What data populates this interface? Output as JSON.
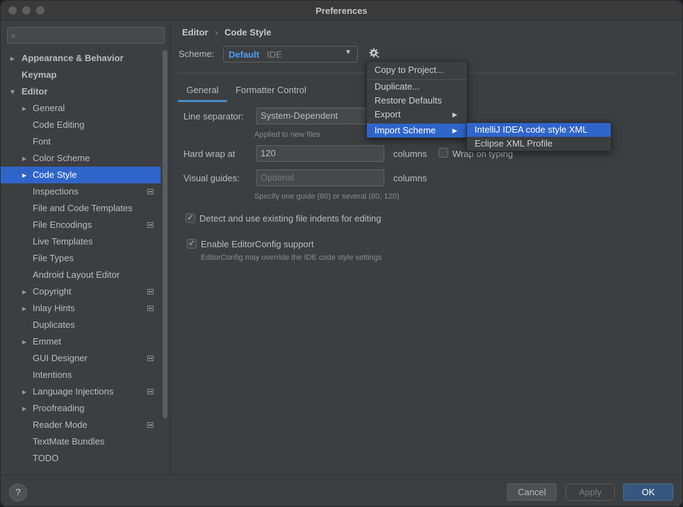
{
  "window": {
    "title": "Preferences"
  },
  "sidebar": {
    "search": {
      "placeholder": "",
      "icon": "search-icon"
    },
    "items": [
      {
        "label": "Appearance & Behavior",
        "expander": "▸"
      },
      {
        "label": "Keymap",
        "expander": ""
      },
      {
        "label": "Editor",
        "expander": "▾"
      },
      {
        "label": "General",
        "expander": "▸"
      },
      {
        "label": "Code Editing",
        "expander": ""
      },
      {
        "label": "Font",
        "expander": ""
      },
      {
        "label": "Color Scheme",
        "expander": "▸"
      },
      {
        "label": "Code Style",
        "expander": "▸",
        "selected": true
      },
      {
        "label": "Inspections",
        "expander": "",
        "project_icon": true
      },
      {
        "label": "File and Code Templates",
        "expander": ""
      },
      {
        "label": "File Encodings",
        "expander": "",
        "project_icon": true
      },
      {
        "label": "Live Templates",
        "expander": ""
      },
      {
        "label": "File Types",
        "expander": ""
      },
      {
        "label": "Android Layout Editor",
        "expander": ""
      },
      {
        "label": "Copyright",
        "expander": "▸",
        "project_icon": true
      },
      {
        "label": "Inlay Hints",
        "expander": "▸",
        "project_icon": true
      },
      {
        "label": "Duplicates",
        "expander": ""
      },
      {
        "label": "Emmet",
        "expander": "▸"
      },
      {
        "label": "GUI Designer",
        "expander": "",
        "project_icon": true
      },
      {
        "label": "Intentions",
        "expander": ""
      },
      {
        "label": "Language Injections",
        "expander": "▸",
        "project_icon": true
      },
      {
        "label": "Proofreading",
        "expander": "▸"
      },
      {
        "label": "Reader Mode",
        "expander": "",
        "project_icon": true
      },
      {
        "label": "TextMate Bundles",
        "expander": ""
      },
      {
        "label": "TODO",
        "expander": ""
      }
    ]
  },
  "breadcrumb": {
    "parent": "Editor",
    "separator": "›",
    "current": "Code Style"
  },
  "scheme": {
    "label": "Scheme:",
    "name": "Default",
    "type": "IDE",
    "gear_icon": "gear-icon"
  },
  "tabs": [
    {
      "label": "General",
      "active": true
    },
    {
      "label": "Formatter Control",
      "active": false
    }
  ],
  "form": {
    "line_separator": {
      "label": "Line separator:",
      "value": "System-Dependent",
      "hint": "Applied to new files"
    },
    "hard_wrap": {
      "label": "Hard wrap at",
      "value": "120",
      "unit": "columns",
      "wrap_on_typing": "Wrap on typing",
      "wrap_on_typing_checked": false
    },
    "visual_guides": {
      "label": "Visual guides:",
      "placeholder": "Optional",
      "unit": "columns",
      "hint": "Specify one guide (80) or several (80, 120)"
    },
    "detect_indents": {
      "label": "Detect and use existing file indents for editing",
      "checked": true
    },
    "editorconfig": {
      "label": "Enable EditorConfig support",
      "checked": true,
      "hint": "EditorConfig may override the IDE code style settings"
    }
  },
  "gear_menu": [
    {
      "label": "Copy to Project..."
    },
    {
      "label": "Duplicate..."
    },
    {
      "label": "Restore Defaults"
    },
    {
      "label": "Export",
      "submenu": true
    },
    {
      "label": "Import Scheme",
      "submenu": true,
      "active": true
    }
  ],
  "import_submenu": [
    {
      "label": "IntelliJ IDEA code style XML",
      "active": true
    },
    {
      "label": "Eclipse XML Profile"
    }
  ],
  "footer": {
    "help": "?",
    "cancel": "Cancel",
    "apply": "Apply",
    "ok": "OK"
  },
  "colors": {
    "selection": "#2f65ca",
    "accent_text": "#4a9ff5",
    "primary_button": "#365880"
  }
}
